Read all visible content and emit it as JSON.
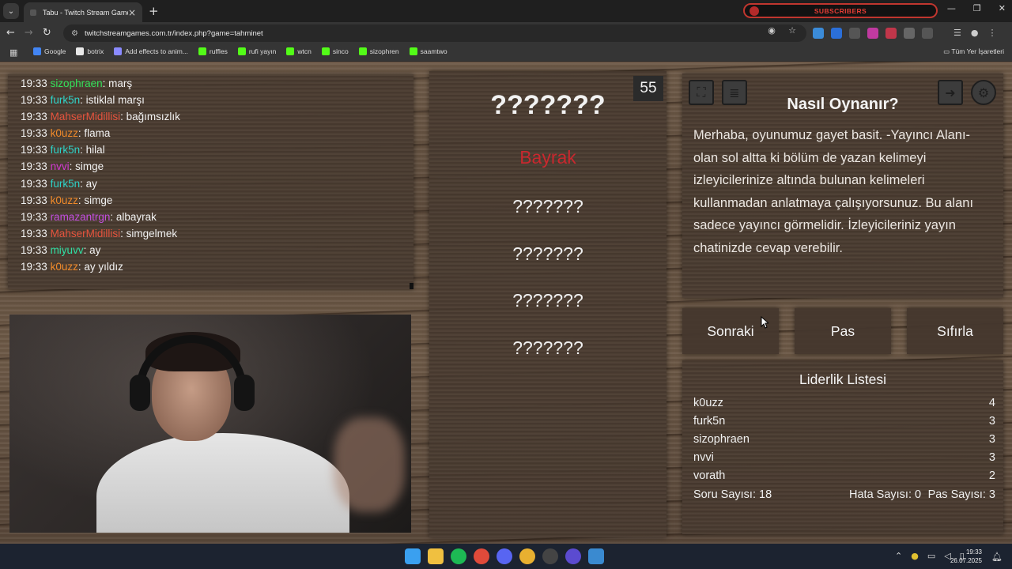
{
  "browser": {
    "tab_title": "Tabu - Twitch Stream Games",
    "banner_text": "SUBSCRIBERS",
    "url": "twitchstreamgames.com.tr/index.php?game=tahminet",
    "bookmarks": [
      {
        "label": "Google",
        "color": "#4285f4"
      },
      {
        "label": "botrix",
        "color": "#e8e8e8"
      },
      {
        "label": "Add effects to anim...",
        "color": "#8a8aff"
      },
      {
        "label": "ruffles",
        "color": "#53fc18"
      },
      {
        "label": "rufi yayın",
        "color": "#53fc18"
      },
      {
        "label": "wtcn",
        "color": "#53fc18"
      },
      {
        "label": "sinco",
        "color": "#53fc18"
      },
      {
        "label": "sizophren",
        "color": "#53fc18"
      },
      {
        "label": "saamtwo",
        "color": "#53fc18"
      }
    ],
    "all_bookmarks": "Tüm Yer İşaretleri"
  },
  "chat": {
    "messages": [
      {
        "time": "19:33",
        "user": "sizophraen",
        "color": "#33e25a",
        "text": "marş"
      },
      {
        "time": "19:33",
        "user": "furk5n",
        "color": "#2ed3c8",
        "text": "istiklal marşı"
      },
      {
        "time": "19:33",
        "user": "MahserMidillisi",
        "color": "#e5533d",
        "text": "bağımsızlık"
      },
      {
        "time": "19:33",
        "user": "k0uzz",
        "color": "#f08a2a",
        "text": "flama"
      },
      {
        "time": "19:33",
        "user": "furk5n",
        "color": "#2ed3c8",
        "text": "hilal"
      },
      {
        "time": "19:33",
        "user": "nvvi",
        "color": "#d23ad2",
        "text": "simge"
      },
      {
        "time": "19:33",
        "user": "furk5n",
        "color": "#2ed3c8",
        "text": "ay"
      },
      {
        "time": "19:33",
        "user": "k0uzz",
        "color": "#f08a2a",
        "text": "simge"
      },
      {
        "time": "19:33",
        "user": "ramazantrgn",
        "color": "#c34fe0",
        "text": "albayrak"
      },
      {
        "time": "19:33",
        "user": "MahserMidillisi",
        "color": "#e5533d",
        "text": "simgelmek"
      },
      {
        "time": "19:33",
        "user": "miyuvv",
        "color": "#2fe0a4",
        "text": "ay"
      },
      {
        "time": "19:33",
        "user": "k0uzz",
        "color": "#f08a2a",
        "text": "ay yıldız"
      }
    ]
  },
  "board": {
    "timer": "55",
    "main_word": "???????",
    "taboo_words": [
      {
        "text": "Bayrak",
        "revealed": true
      },
      {
        "text": "???????",
        "revealed": false
      },
      {
        "text": "???????",
        "revealed": false
      },
      {
        "text": "???????",
        "revealed": false
      },
      {
        "text": "???????",
        "revealed": false
      }
    ]
  },
  "howto": {
    "title": "Nasıl Oynanır?",
    "text": "Merhaba, oyunumuz gayet basit. -Yayıncı Alanı- olan sol altta ki bölüm de yazan kelimeyi izleyicilerinize altında bulunan kelimeleri kullanmadan anlatmaya çalışıyorsunuz. Bu alanı sadece yayıncı görmelidir. İzleyicileriniz yayın chatinizde cevap verebilir."
  },
  "actions": {
    "next": "Sonraki",
    "pass": "Pas",
    "reset": "Sıfırla"
  },
  "leaderboard": {
    "title": "Liderlik Listesi",
    "rows": [
      {
        "name": "k0uzz",
        "score": "4"
      },
      {
        "name": "furk5n",
        "score": "3"
      },
      {
        "name": "sizophraen",
        "score": "3"
      },
      {
        "name": "nvvi",
        "score": "3"
      },
      {
        "name": "vorath",
        "score": "2"
      }
    ],
    "question_count": "Soru Sayısı: 18",
    "error_count": "Hata Sayısı: 0",
    "pass_count": "Pas Sayısı: 3"
  },
  "taskbar": {
    "time": "19:33",
    "date": "26.07.2025"
  }
}
